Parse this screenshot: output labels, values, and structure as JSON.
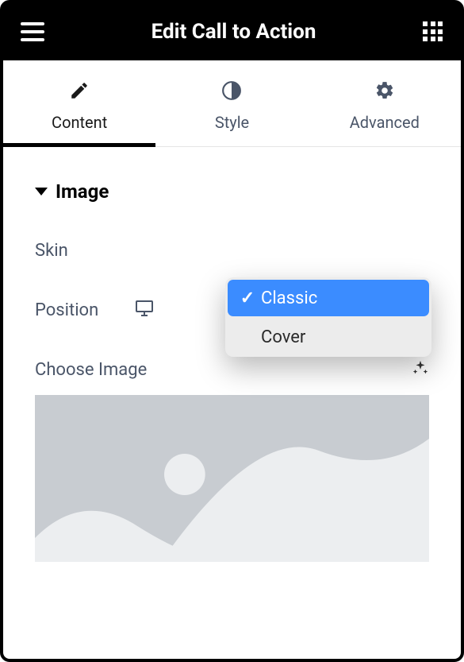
{
  "header": {
    "title": "Edit Call to Action"
  },
  "tabs": {
    "content": "Content",
    "style": "Style",
    "advanced": "Advanced"
  },
  "section": {
    "title": "Image"
  },
  "skin": {
    "label": "Skin",
    "options": [
      "Classic",
      "Cover"
    ],
    "selected": "Classic"
  },
  "position": {
    "label": "Position"
  },
  "chooseImage": {
    "label": "Choose Image"
  }
}
